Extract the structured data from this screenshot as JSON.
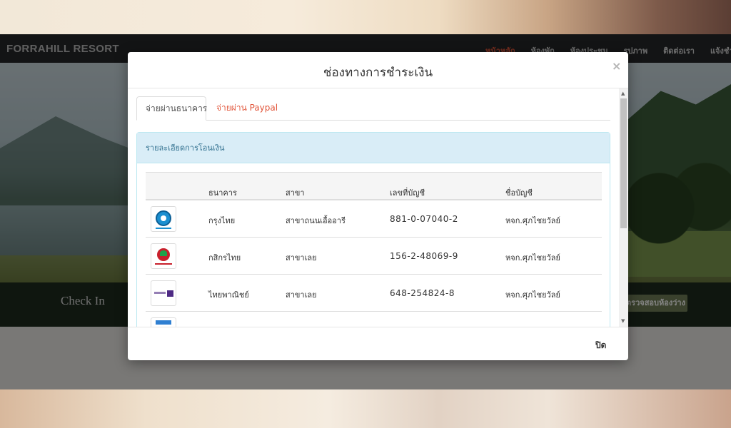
{
  "site": {
    "brand": "FORRAHILL RESORT",
    "nav": [
      "หน้าหลัก",
      "ห้องพัก",
      "ห้องประชุม",
      "รูปภาพ",
      "ติดต่อเรา",
      "แจ้งชำ"
    ],
    "booking": {
      "checkin_label": "Check In",
      "check_button": "ตรวจสอบห้องว่าง"
    }
  },
  "modal": {
    "title": "ช่องทางการชำระเงิน",
    "close_icon": "×",
    "tabs": [
      {
        "label": "จ่ายผ่านธนาคาร",
        "active": true
      },
      {
        "label": "จ่ายผ่าน Paypal",
        "active": false
      }
    ],
    "panel_heading": "รายละเอียดการโอนเงิน",
    "table": {
      "headers": [
        "ธนาคาร",
        "สาขา",
        "เลขที่บัญชี",
        "ชื่อบัญชี"
      ],
      "rows": [
        {
          "logo": "ktb-logo",
          "bank": "กรุงไทย",
          "branch": "สาขาถนนเอื้ออารี",
          "account": "881-0-07040-2",
          "owner": "หจก.ศุภไชยวัลย์"
        },
        {
          "logo": "kbank-logo",
          "bank": "กสิกรไทย",
          "branch": "สาขาเลย",
          "account": "156-2-48069-9",
          "owner": "หจก.ศุภไชยวัลย์"
        },
        {
          "logo": "scb-logo",
          "bank": "ไทยพาณิชย์",
          "branch": "สาขาเลย",
          "account": "648-254824-8",
          "owner": "หจก.ศุภไชยวัลย์"
        }
      ]
    },
    "footer_close": "ปิด"
  }
}
